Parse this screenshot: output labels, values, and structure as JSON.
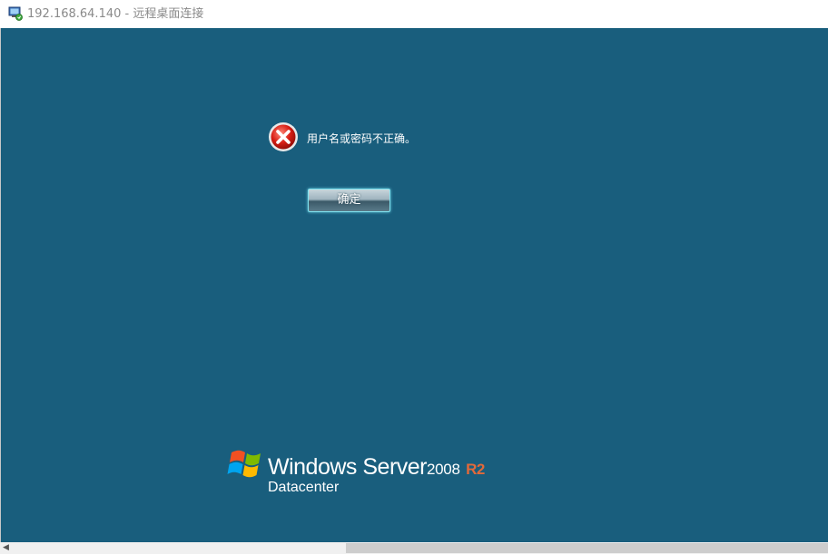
{
  "window": {
    "title": "192.168.64.140 - 远程桌面连接",
    "icon": "remote-desktop-icon"
  },
  "dialog": {
    "icon": "error-icon",
    "message": "用户名或密码不正确。",
    "ok_label": "确定"
  },
  "branding": {
    "logo": "windows-flag-logo",
    "product_name": "Windows Server",
    "version": "2008",
    "release": "R2",
    "edition": "Datacenter"
  },
  "scrollbar": {
    "left_arrow_icon": "chevron-left-icon"
  },
  "colors": {
    "desktop_background": "#195e7d",
    "title_text": "#8a8a8a",
    "release_accent": "#e2693a",
    "button_glow": "#7fe3f0"
  }
}
